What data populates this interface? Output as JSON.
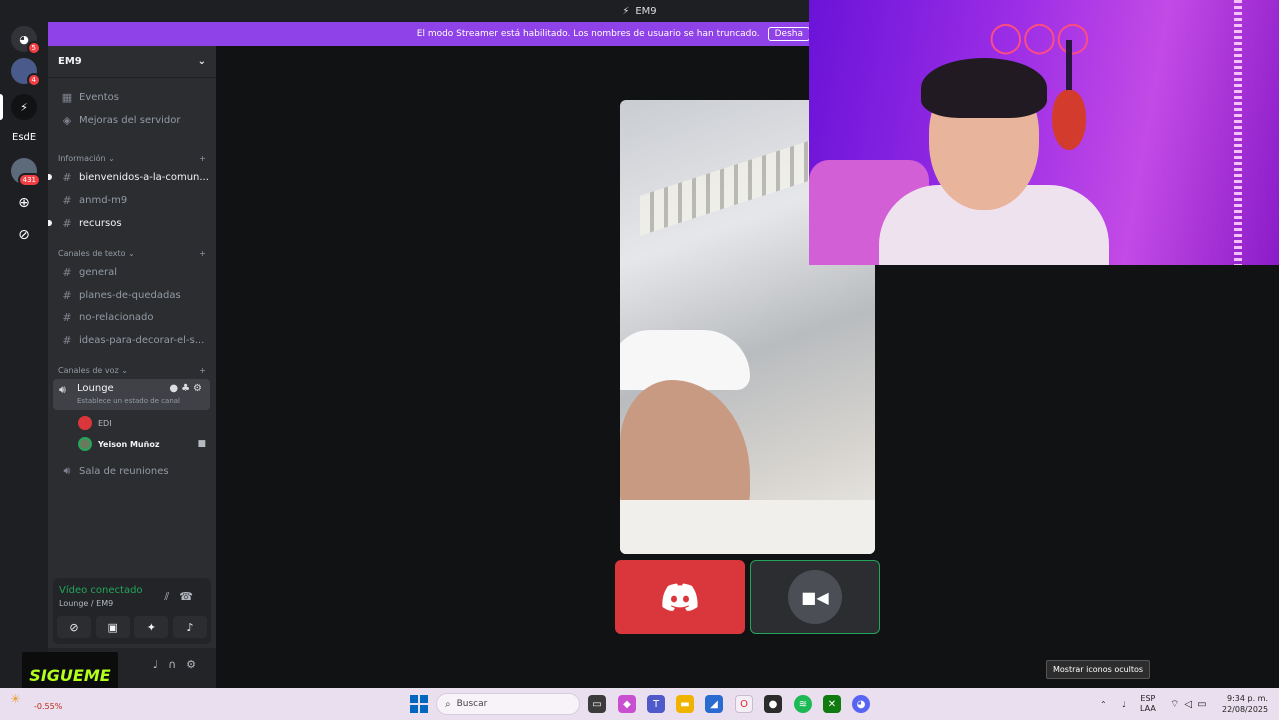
{
  "window": {
    "title": "EM9"
  },
  "banner": {
    "text": "El modo Streamer está habilitado. Los nombres de usuario se han truncado.",
    "button": "Desha"
  },
  "rail": {
    "badges": {
      "home": "5",
      "server1": "4",
      "server4": "431"
    },
    "label_server": "EsdE"
  },
  "sidebar": {
    "server_name": "EM9",
    "top_items": [
      {
        "label": "Eventos",
        "icon": "calendar-icon"
      },
      {
        "label": "Mejoras del servidor",
        "icon": "boost-icon"
      }
    ],
    "cat_info": "Información",
    "info_channels": [
      "bienvenidos-a-la-comun...",
      "anmd-m9",
      "recursos"
    ],
    "cat_text": "Canales de texto",
    "text_channels": [
      "general",
      "planes-de-quedadas",
      "no-relacionado",
      "ideas-para-decorar-el-s..."
    ],
    "cat_voice": "Canales de voz",
    "voice_active": {
      "name": "Lounge",
      "status_hint": "Establece un estado de canal"
    },
    "voice_users": [
      "EDI",
      "Yeison Muñoz"
    ],
    "voice_other": "Sala de reuniones"
  },
  "voice_panel": {
    "status": "Vídeo conectado",
    "where": "Lounge / EM9"
  },
  "overlay": {
    "sigueme": "SIGUEME"
  },
  "tooltip": "Mostrar iconos ocultos",
  "taskbar": {
    "weather": "-0.55%",
    "search_placeholder": "Buscar",
    "lang": "ESP",
    "lang2": "LAA",
    "time": "9:34 p. m.",
    "date": "22/08/2025"
  },
  "colors": {
    "banner": "#8f42e8",
    "voice_connected": "#23a55a",
    "discord_tile": "#da373c"
  }
}
